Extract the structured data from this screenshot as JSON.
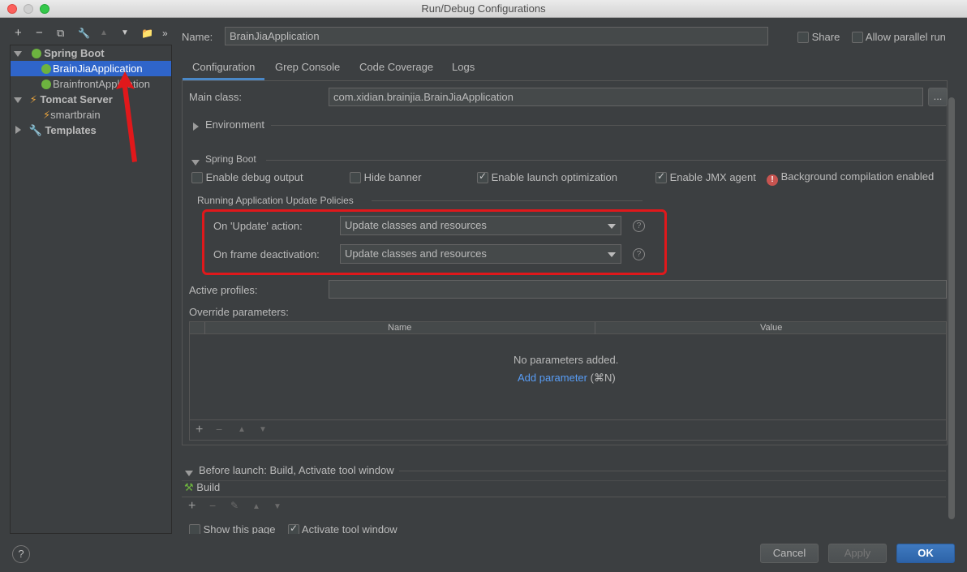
{
  "window": {
    "title": "Run/Debug Configurations"
  },
  "toolbar": {
    "add": "+",
    "remove": "−",
    "copy": "⧉",
    "edit": "🔧",
    "up": "▲",
    "down": "▼",
    "folder": "📁",
    "more": "»"
  },
  "tree": {
    "spring_boot": "Spring Boot",
    "app1": "BrainJiaApplication",
    "app2": "BrainfrontApplication",
    "tomcat": "Tomcat Server",
    "smartbrain": "smartbrain",
    "templates": "Templates"
  },
  "header": {
    "name_label": "Name:",
    "name_value": "BrainJiaApplication",
    "share": "Share",
    "parallel": "Allow parallel run"
  },
  "tabs": [
    "Configuration",
    "Grep Console",
    "Code Coverage",
    "Logs"
  ],
  "config": {
    "main_class_label": "Main class:",
    "main_class_value": "com.xidian.brainjia.BrainJiaApplication",
    "browse": "...",
    "environment": "Environment",
    "spring_boot": "Spring Boot",
    "enable_debug": "Enable debug output",
    "hide_banner": "Hide banner",
    "launch_opt": "Enable launch optimization",
    "jmx": "Enable JMX agent",
    "bg_compile": "Background compilation enabled",
    "policies": "Running Application Update Policies",
    "update_label": "On 'Update' action:",
    "update_value": "Update classes and resources",
    "deact_label": "On frame deactivation:",
    "deact_value": "Update classes and resources",
    "help": "?",
    "active_profiles": "Active profiles:",
    "override": "Override parameters:",
    "col_name": "Name",
    "col_value": "Value",
    "no_params": "No parameters added.",
    "add_param": "Add parameter",
    "shortcut": "(⌘N)"
  },
  "before_launch": {
    "title": "Before launch: Build, Activate tool window",
    "build": "Build",
    "show_page": "Show this page",
    "activate": "Activate tool window"
  },
  "buttons": {
    "help": "?",
    "cancel": "Cancel",
    "apply": "Apply",
    "ok": "OK"
  },
  "colors": {
    "accent": "#2f65ca",
    "highlight": "#e0181b",
    "link": "#589df6",
    "spring": "#6db33f"
  }
}
